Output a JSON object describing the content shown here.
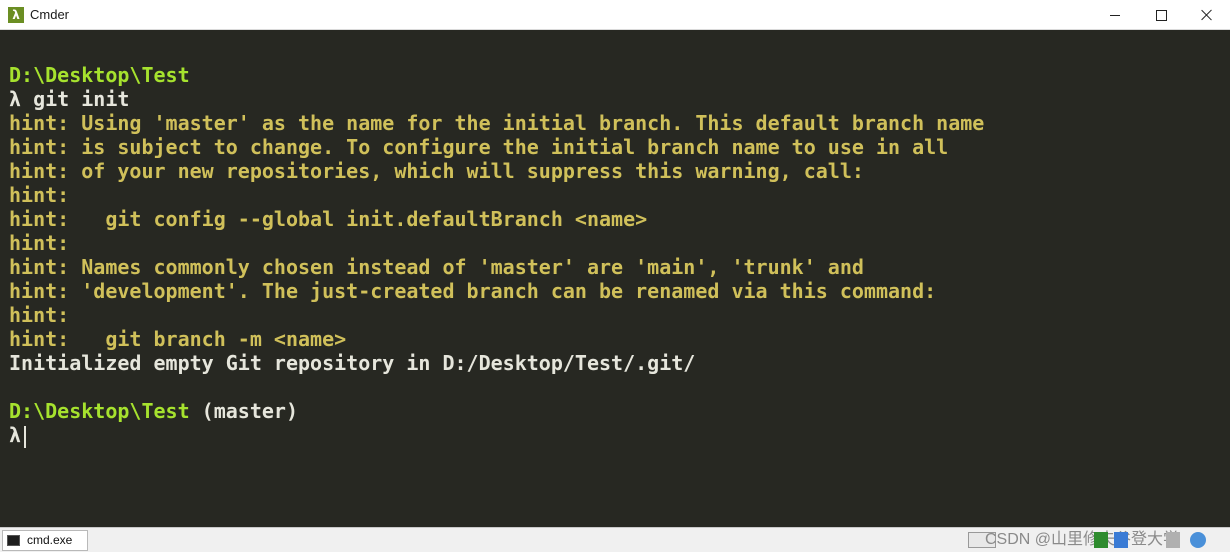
{
  "window": {
    "title": "Cmder",
    "app_icon_glyph": "λ",
    "buttons": [
      "minimize-icon",
      "maximize-icon",
      "close-icon"
    ]
  },
  "terminal": {
    "lines": [
      {
        "segments": [
          {
            "text": "D:\\Desktop\\Test",
            "style": "path"
          }
        ]
      },
      {
        "segments": [
          {
            "text": "λ ",
            "style": "lambda"
          },
          {
            "text": "git init",
            "style": "text"
          }
        ]
      },
      {
        "segments": [
          {
            "text": "hint: Using 'master' as the name for the initial branch. This default branch name",
            "style": "hint"
          }
        ]
      },
      {
        "segments": [
          {
            "text": "hint: is subject to change. To configure the initial branch name to use in all",
            "style": "hint"
          }
        ]
      },
      {
        "segments": [
          {
            "text": "hint: of your new repositories, which will suppress this warning, call:",
            "style": "hint"
          }
        ]
      },
      {
        "segments": [
          {
            "text": "hint:",
            "style": "hint"
          }
        ]
      },
      {
        "segments": [
          {
            "text": "hint:   git config --global init.defaultBranch <name>",
            "style": "hint"
          }
        ]
      },
      {
        "segments": [
          {
            "text": "hint:",
            "style": "hint"
          }
        ]
      },
      {
        "segments": [
          {
            "text": "hint: Names commonly chosen instead of 'master' are 'main', 'trunk' and",
            "style": "hint"
          }
        ]
      },
      {
        "segments": [
          {
            "text": "hint: 'development'. The just-created branch can be renamed via this command:",
            "style": "hint"
          }
        ]
      },
      {
        "segments": [
          {
            "text": "hint:",
            "style": "hint"
          }
        ]
      },
      {
        "segments": [
          {
            "text": "hint:   git branch -m <name>",
            "style": "hint"
          }
        ]
      },
      {
        "segments": [
          {
            "text": "Initialized empty Git repository in D:/Desktop/Test/.git/",
            "style": "text"
          }
        ]
      },
      {
        "segments": []
      },
      {
        "segments": [
          {
            "text": "D:\\Desktop\\Test",
            "style": "path"
          },
          {
            "text": " (master)",
            "style": "text"
          }
        ]
      },
      {
        "segments": [
          {
            "text": "λ",
            "style": "lambda"
          }
        ],
        "cursor": true
      }
    ],
    "colors": {
      "background": "#272822",
      "path": "#a6e22e",
      "hint": "#d0c05a",
      "text": "#e6e6dc"
    }
  },
  "statusbar": {
    "tab_label": "cmd.exe",
    "tab_icon": "console-icon",
    "watermark": "CSDN @山里修夫谷登大学"
  }
}
